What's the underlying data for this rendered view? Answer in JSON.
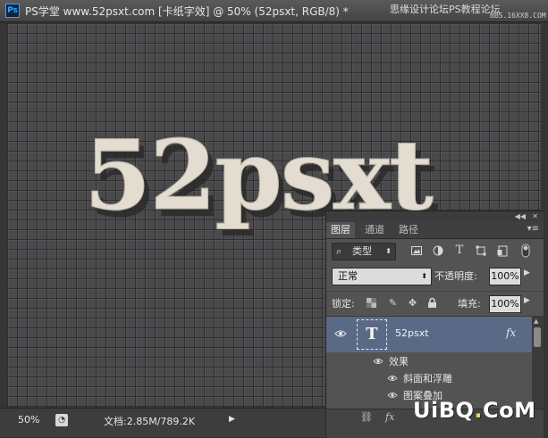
{
  "window": {
    "app_icon": "Ps",
    "title": "PS学堂 www.52psxt.com [卡纸字效] @ 50% (52psxt, RGB/8) *"
  },
  "watermark_top": {
    "text": "思缘设计论坛",
    "right": "PS教程论坛",
    "site": "BBS.16XX8.COM"
  },
  "artwork": {
    "text": "52psxt",
    "fill": "#e3dcd0",
    "shadow": "#2b2b2b"
  },
  "layers_panel": {
    "tabs": [
      {
        "label": "图层",
        "active": true
      },
      {
        "label": "通道"
      },
      {
        "label": "路径"
      }
    ],
    "filter": {
      "label": "类型",
      "icons": [
        "image-filter-icon",
        "adjustment-filter-icon",
        "text-filter-icon",
        "shape-filter-icon",
        "smart-object-filter-icon"
      ]
    },
    "blend_mode": "正常",
    "opacity_label": "不透明度:",
    "opacity": "100%",
    "lock_label": "锁定:",
    "fill_label": "填充:",
    "fill": "100%",
    "layer": {
      "name": "52psxt",
      "thumb": "T",
      "fx": "fx"
    },
    "effects_label": "效果",
    "effects": [
      "斜面和浮雕",
      "图案叠加"
    ]
  },
  "status": {
    "zoom": "50%",
    "doc_info": "文档:2.85M/789.2K"
  },
  "watermark_bottom": {
    "text1": "UiBQ",
    "dot": ".",
    "text2": "CoM"
  }
}
